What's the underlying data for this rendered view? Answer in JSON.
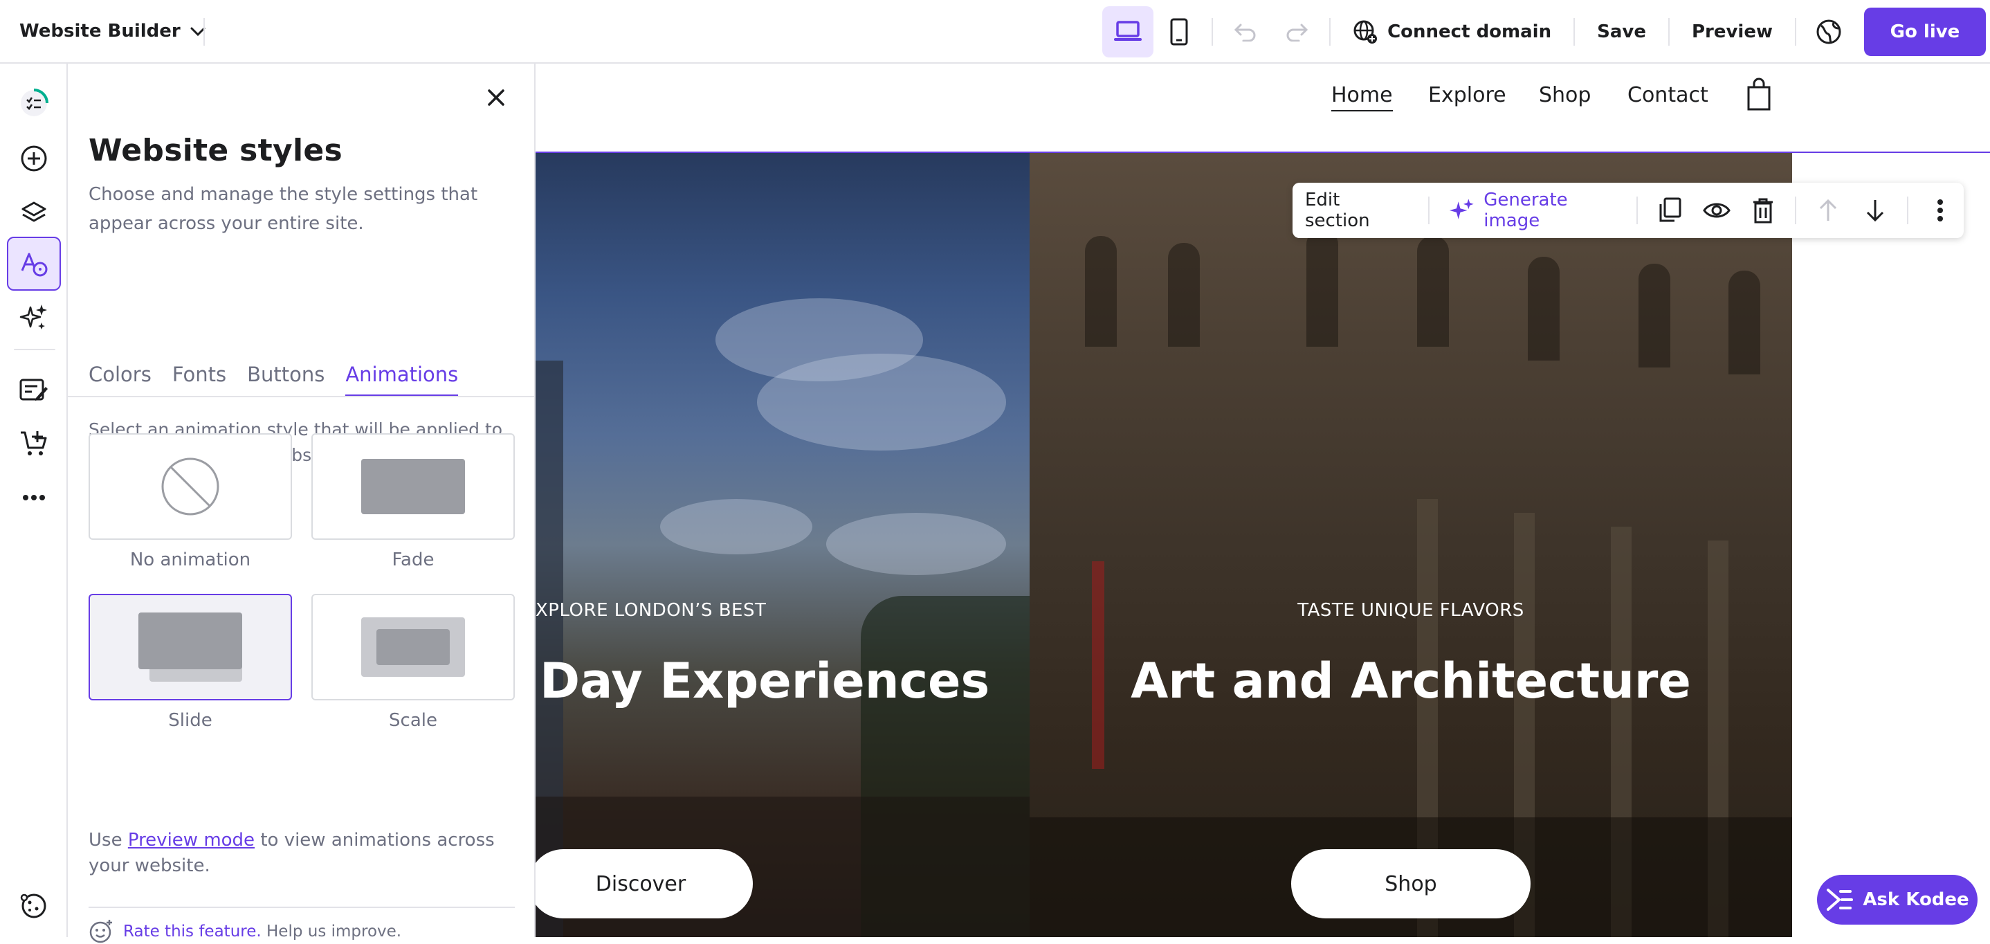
{
  "topbar": {
    "app_title": "Website Builder",
    "connect_domain": "Connect domain",
    "save": "Save",
    "preview": "Preview",
    "go_live": "Go live"
  },
  "panel": {
    "title": "Website styles",
    "subtitle": "Choose and manage the style settings that appear across your entire site.",
    "tabs": [
      {
        "label": "Colors"
      },
      {
        "label": "Fonts"
      },
      {
        "label": "Buttons"
      },
      {
        "label": "Animations",
        "active": true
      }
    ],
    "description": "Select an animation style that will be applied to all elements of your website.",
    "options": [
      {
        "label": "No animation"
      },
      {
        "label": "Fade"
      },
      {
        "label": "Slide",
        "selected": true
      },
      {
        "label": "Scale"
      }
    ],
    "footer_prefix": "Use ",
    "footer_link": "Preview mode",
    "footer_suffix": " to view animations across your website.",
    "rate_link": "Rate this feature.",
    "rate_suffix": " Help us improve."
  },
  "site_nav": {
    "items": [
      "Home",
      "Explore",
      "Shop",
      "Contact"
    ]
  },
  "edit_toolbar": {
    "edit_section": "Edit section",
    "generate_image": "Generate image"
  },
  "hero": {
    "left": {
      "kicker": "XPLORE LONDON’S BEST",
      "headline": "Day Experiences",
      "button": "Discover"
    },
    "right": {
      "kicker": "TASTE UNIQUE FLAVORS",
      "headline": "Art and Architecture",
      "button": "Shop"
    }
  },
  "assistant": {
    "label": "Ask Kodee"
  },
  "colors": {
    "accent": "#673de6",
    "accent_soft": "#ebe4ff",
    "text": "#1d1e20",
    "muted": "#6d7081"
  }
}
